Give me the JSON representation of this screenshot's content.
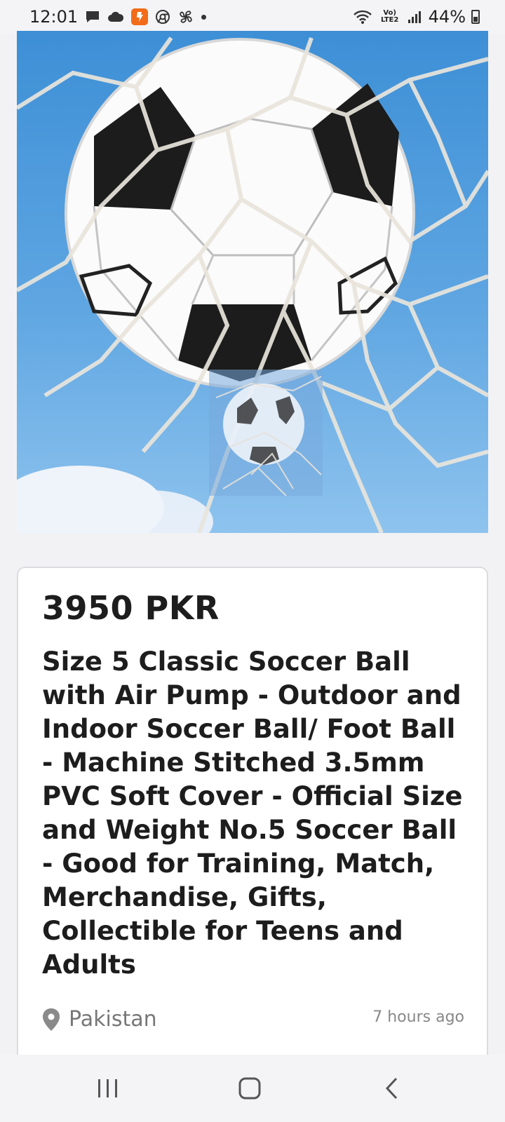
{
  "status": {
    "time": "12:01",
    "network_label": "Vo) LTE2",
    "battery": "44%"
  },
  "listing": {
    "price": "3950 PKR",
    "title": "Size 5 Classic Soccer Ball with Air Pump - Outdoor and Indoor Soccer Ball/ Foot Ball - Machine Stitched 3.5mm PVC Soft Cover - Official Size and Weight No.5 Soccer Ball - Good for Training, Match, Merchandise, Gifts, Collectible for Teens and Adults",
    "location": "Pakistan",
    "posted": "7 hours ago"
  },
  "icons": {
    "status_left": [
      "message-icon",
      "cloud-icon",
      "app-notification-icon",
      "chrome-icon",
      "fan-icon"
    ],
    "status_right": [
      "wifi-icon",
      "signal-icon",
      "battery-icon"
    ],
    "location": "location-pin-icon",
    "nav": [
      "recents-icon",
      "home-icon",
      "back-icon"
    ]
  }
}
